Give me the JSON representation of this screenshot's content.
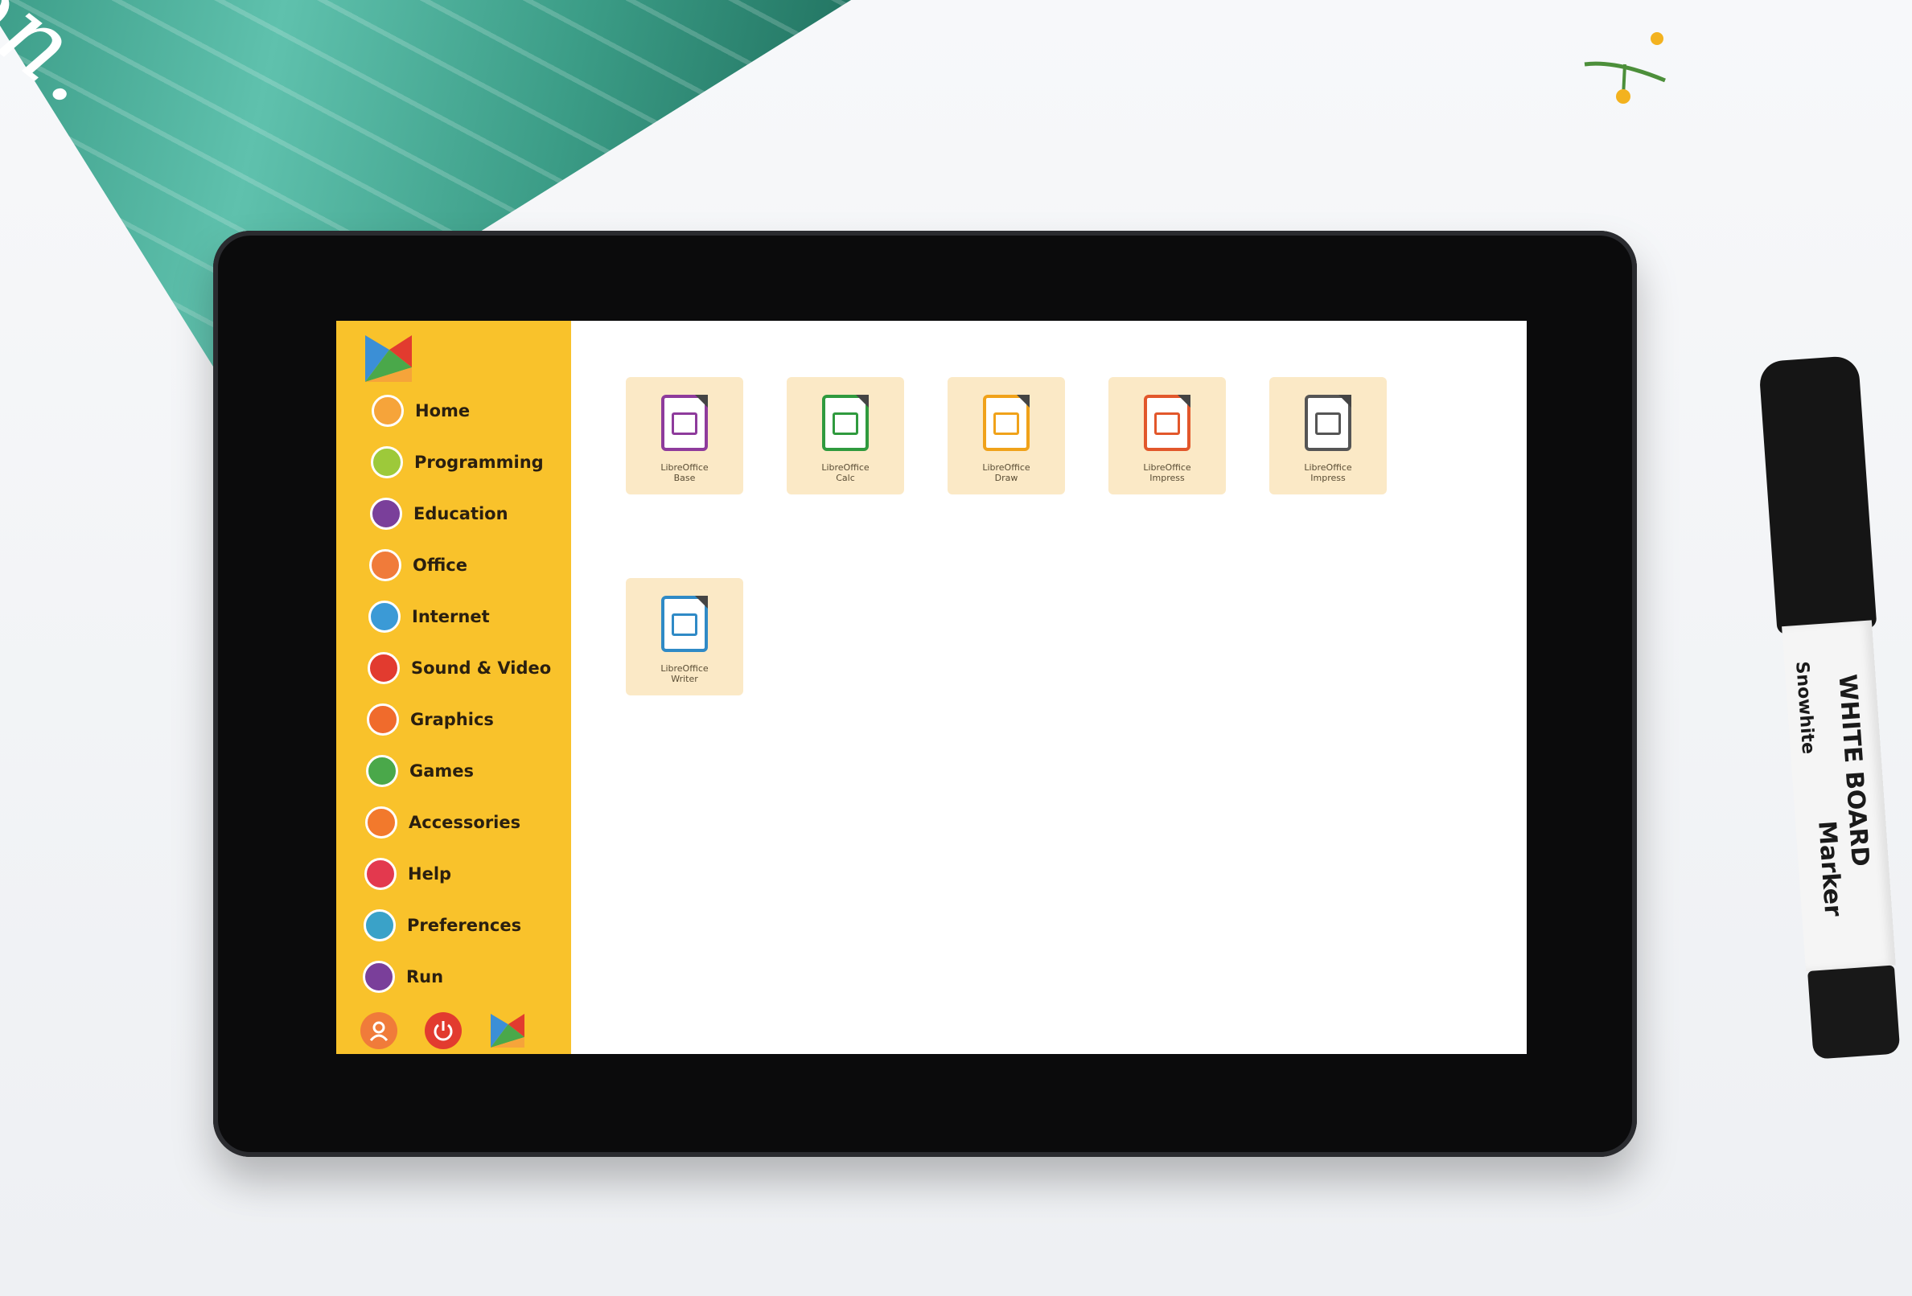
{
  "book": {
    "cover_text": "tion."
  },
  "sidebar": {
    "items": [
      {
        "label": "Home",
        "icon": "home-icon",
        "color": "#f6a43a"
      },
      {
        "label": "Programming",
        "icon": "programming-icon",
        "color": "#9dc93a"
      },
      {
        "label": "Education",
        "icon": "education-icon",
        "color": "#7a3f9a"
      },
      {
        "label": "Office",
        "icon": "office-icon",
        "color": "#f07b3a"
      },
      {
        "label": "Internet",
        "icon": "internet-icon",
        "color": "#3b9ad6"
      },
      {
        "label": "Sound & Video",
        "icon": "sound-video-icon",
        "color": "#e23b2f"
      },
      {
        "label": "Graphics",
        "icon": "graphics-icon",
        "color": "#f06b2c"
      },
      {
        "label": "Games",
        "icon": "games-icon",
        "color": "#4aa84a"
      },
      {
        "label": "Accessories",
        "icon": "accessories-icon",
        "color": "#f2792c"
      },
      {
        "label": "Help",
        "icon": "help-icon",
        "color": "#e3394e"
      },
      {
        "label": "Preferences",
        "icon": "preferences-icon",
        "color": "#3aa2c8"
      },
      {
        "label": "Run",
        "icon": "run-icon",
        "color": "#7a3f9a"
      }
    ],
    "bottom": [
      {
        "icon": "user-icon",
        "color": "#f07b3a"
      },
      {
        "icon": "power-icon",
        "color": "#e23b2f"
      },
      {
        "icon": "app-logo-icon",
        "color": "#f6a43a"
      }
    ]
  },
  "apps": [
    {
      "line1": "LibreOffice",
      "line2": "Base",
      "color": "#8e3b9c"
    },
    {
      "line1": "LibreOffice",
      "line2": "Calc",
      "color": "#2f9a3e"
    },
    {
      "line1": "LibreOffice",
      "line2": "Draw",
      "color": "#f0a21a"
    },
    {
      "line1": "LibreOffice",
      "line2": "Impress",
      "color": "#e2572b"
    },
    {
      "line1": "LibreOffice",
      "line2": "Impress",
      "color": "#555555"
    },
    {
      "line1": "LibreOffice",
      "line2": "Writer",
      "color": "#2f8ac6"
    }
  ],
  "marker": {
    "brand": "WHITE BOARD",
    "line2": "Snowhite",
    "line3": "Marker"
  }
}
